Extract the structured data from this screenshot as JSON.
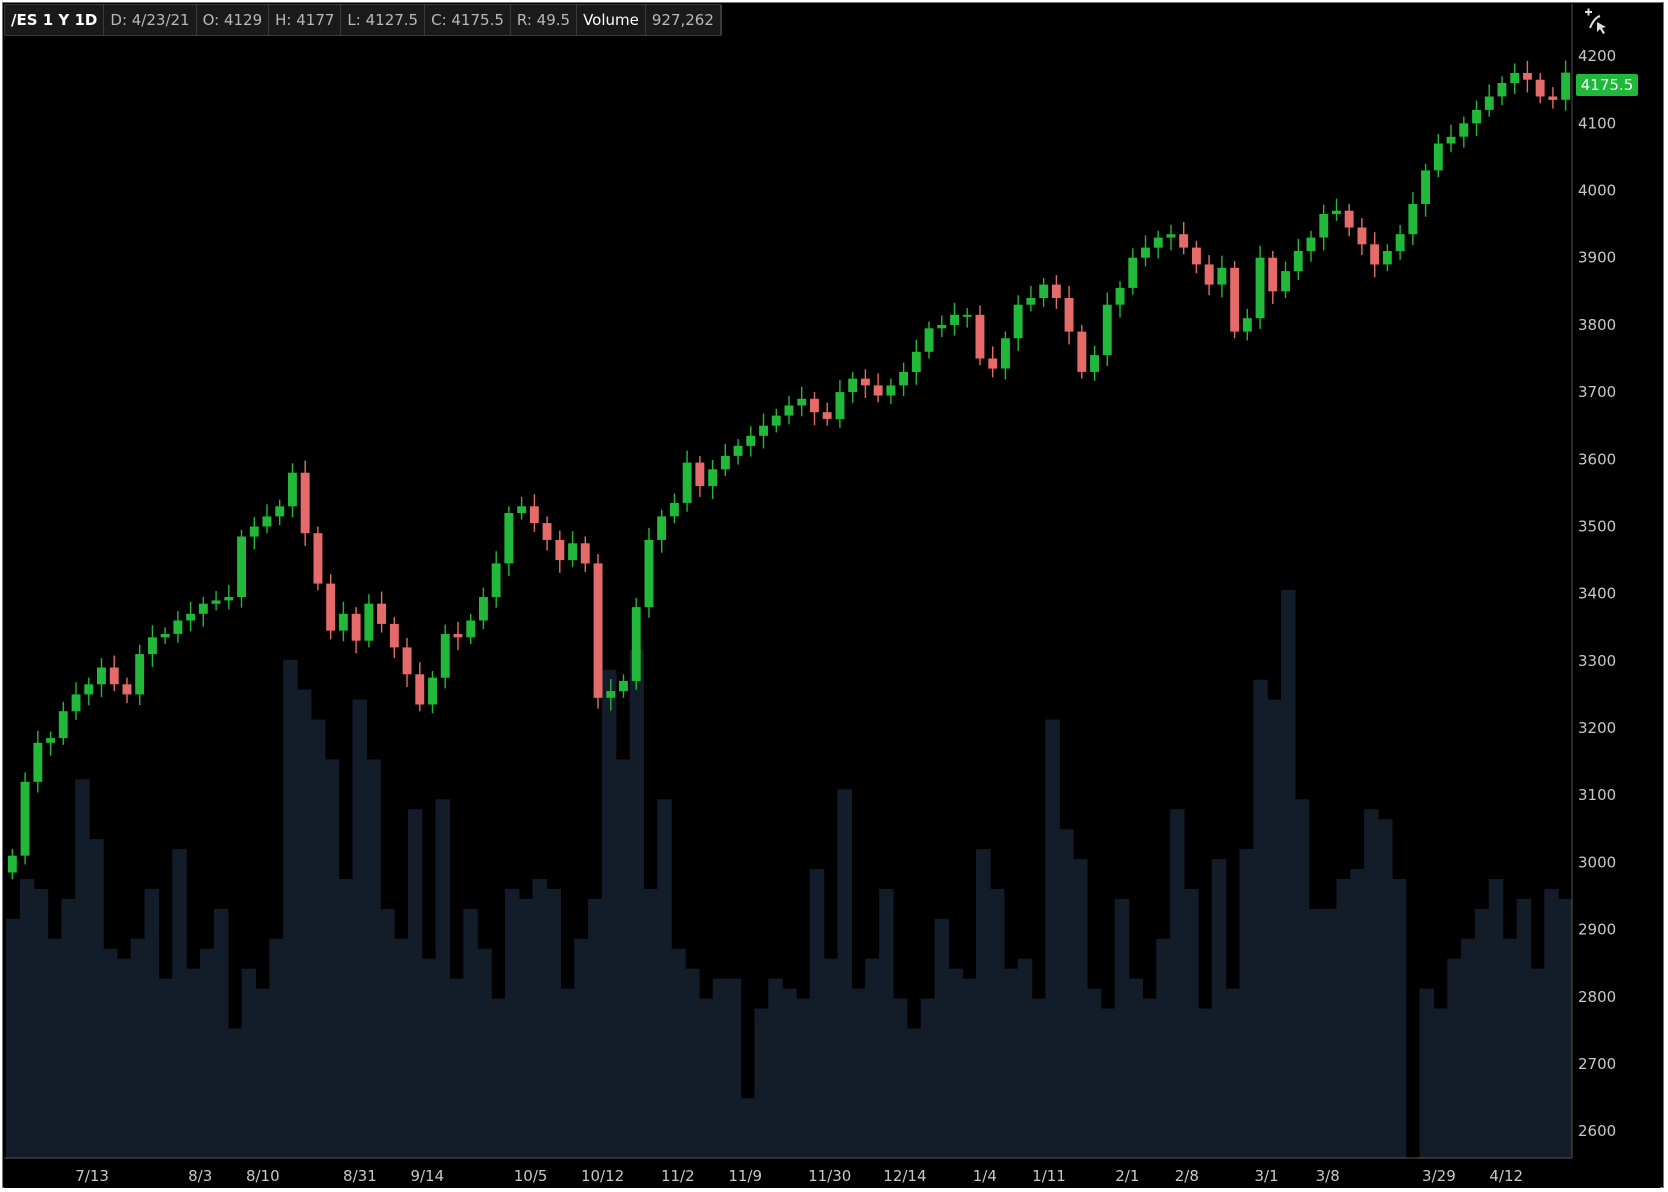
{
  "header": {
    "symbol": "/ES 1 Y 1D",
    "date": "D: 4/23/21",
    "open": "O: 4129",
    "high": "H: 4177",
    "low": "L: 4127.5",
    "close": "C: 4175.5",
    "range": "R: 49.5",
    "volume_label": "Volume",
    "volume_value": "927,262"
  },
  "price_badge": "4175.5",
  "icons": {
    "toolbar": "crosshair-cursor-icon"
  },
  "colors": {
    "up": "#22b83a",
    "down": "#e56b6b",
    "volume": "#131c29",
    "background": "#000000",
    "text": "#c8c8c8"
  },
  "chart_data": {
    "type": "candlestick",
    "title": "/ES 1 Y 1D",
    "ylim": [
      2560,
      4230
    ],
    "yticks": [
      2600,
      2700,
      2800,
      2900,
      3000,
      3100,
      3200,
      3300,
      3400,
      3500,
      3600,
      3700,
      3800,
      3900,
      4000,
      4100,
      4200
    ],
    "xticks": [
      "7/13",
      "8/3",
      "8/10",
      "8/31",
      "9/14",
      "10/5",
      "10/12",
      "11/2",
      "11/9",
      "11/30",
      "12/14",
      "1/4",
      "1/11",
      "2/1",
      "2/8",
      "3/1",
      "3/8",
      "3/29",
      "4/12"
    ],
    "grid": false,
    "series": [
      {
        "name": "Price",
        "type": "candlestick",
        "close": [
          3010,
          3120,
          3178,
          3185,
          3225,
          3250,
          3265,
          3290,
          3265,
          3250,
          3310,
          3335,
          3340,
          3360,
          3370,
          3385,
          3390,
          3395,
          3485,
          3500,
          3515,
          3530,
          3580,
          3490,
          3415,
          3345,
          3370,
          3330,
          3385,
          3355,
          3320,
          3280,
          3235,
          3275,
          3340,
          3335,
          3360,
          3395,
          3445,
          3520,
          3530,
          3505,
          3480,
          3450,
          3475,
          3445,
          3245,
          3255,
          3270,
          3380,
          3480,
          3515,
          3535,
          3595,
          3560,
          3585,
          3605,
          3620,
          3635,
          3650,
          3665,
          3680,
          3690,
          3670,
          3660,
          3700,
          3720,
          3710,
          3695,
          3710,
          3730,
          3760,
          3795,
          3800,
          3815,
          3815,
          3750,
          3735,
          3780,
          3830,
          3840,
          3860,
          3840,
          3790,
          3730,
          3755,
          3830,
          3855,
          3900,
          3915,
          3930,
          3935,
          3915,
          3890,
          3860,
          3885,
          3790,
          3810,
          3900,
          3850,
          3880,
          3910,
          3930,
          3965,
          3970,
          3945,
          3920,
          3890,
          3910,
          3935,
          3980,
          4030,
          4070,
          4080,
          4100,
          4120,
          4140,
          4160,
          4175,
          4165,
          4140,
          4135,
          4175.5
        ]
      },
      {
        "name": "Volume",
        "type": "bar",
        "values": [
          1.2,
          1.4,
          1.35,
          1.1,
          1.3,
          1.9,
          1.6,
          1.05,
          1.0,
          1.1,
          1.35,
          0.9,
          1.55,
          0.95,
          1.05,
          1.25,
          0.65,
          0.95,
          0.85,
          1.1,
          2.5,
          2.35,
          2.2,
          2.0,
          1.4,
          2.3,
          2.0,
          1.25,
          1.1,
          1.75,
          1.0,
          1.8,
          0.9,
          1.25,
          1.05,
          0.8,
          1.35,
          1.3,
          1.4,
          1.35,
          0.85,
          1.1,
          1.3,
          2.45,
          2.0,
          2.55,
          1.35,
          1.8,
          1.05,
          0.95,
          0.8,
          0.9,
          0.9,
          0.3,
          0.75,
          0.9,
          0.85,
          0.8,
          1.45,
          1.0,
          1.85,
          0.85,
          1.0,
          1.35,
          0.8,
          0.65,
          0.8,
          1.2,
          0.95,
          0.9,
          1.55,
          1.35,
          0.95,
          1.0,
          0.8,
          2.2,
          1.65,
          1.5,
          0.85,
          0.75,
          1.3,
          0.9,
          0.8,
          1.1,
          1.75,
          1.35,
          0.75,
          1.5,
          0.85,
          1.55,
          2.4,
          2.3,
          2.85,
          1.8,
          1.25,
          1.25,
          1.4,
          1.45,
          1.75,
          1.7,
          1.4,
          0.0,
          0.85,
          0.75,
          1.0,
          1.1,
          1.25,
          1.4,
          1.1,
          1.3,
          0.95,
          1.35,
          1.3
        ]
      }
    ]
  }
}
